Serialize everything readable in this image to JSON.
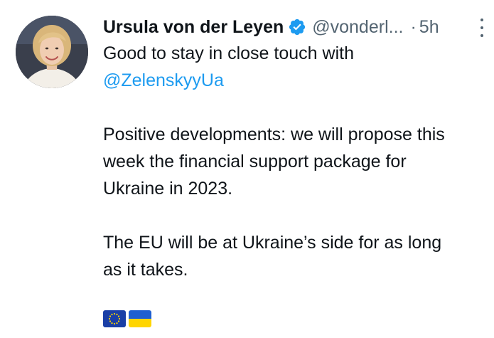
{
  "tweet": {
    "author_name": "Ursula von der Leyen",
    "handle": "@vonderl...",
    "separator": "·",
    "time": "5h",
    "verified_icon": "verified-badge-icon",
    "more_icon": "more-options-icon",
    "lines": [
      "Good to stay in close touch with",
      "@ZelenskyyUa",
      "Positive developments: we will propose this",
      "week the financial support package for",
      "Ukraine in 2023.",
      "The EU will be at Ukraine’s side for as long",
      "as it takes."
    ],
    "flags": [
      "eu-flag-icon",
      "ukraine-flag-icon"
    ]
  },
  "colors": {
    "text": "#0f1419",
    "secondary": "#536471",
    "mention": "#1d9bf0",
    "verified": "#1d9bf0"
  }
}
